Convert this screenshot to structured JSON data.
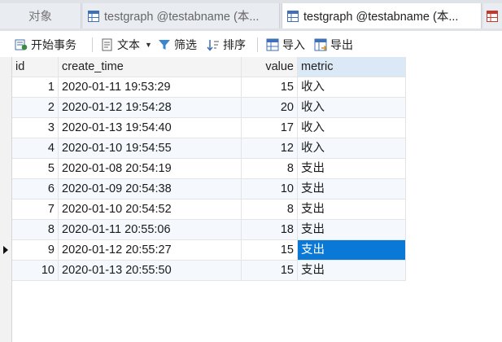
{
  "tabs": {
    "objects": "对象",
    "tab1": "testgraph @testabname (本...",
    "tab2": "testgraph @testabname (本..."
  },
  "toolbar": {
    "begin_transaction": "开始事务",
    "text": "文本",
    "filter": "筛选",
    "sort": "排序",
    "import": "导入",
    "export": "导出"
  },
  "table": {
    "columns": [
      "id",
      "create_time",
      "value",
      "metric"
    ],
    "rows": [
      {
        "id": "1",
        "create_time": "2020-01-11 19:53:29",
        "value": "15",
        "metric": "收入"
      },
      {
        "id": "2",
        "create_time": "2020-01-12 19:54:28",
        "value": "20",
        "metric": "收入"
      },
      {
        "id": "3",
        "create_time": "2020-01-13 19:54:40",
        "value": "17",
        "metric": "收入"
      },
      {
        "id": "4",
        "create_time": "2020-01-10 19:54:55",
        "value": "12",
        "metric": "收入"
      },
      {
        "id": "5",
        "create_time": "2020-01-08 20:54:19",
        "value": "8",
        "metric": "支出"
      },
      {
        "id": "6",
        "create_time": "2020-01-09 20:54:38",
        "value": "10",
        "metric": "支出"
      },
      {
        "id": "7",
        "create_time": "2020-01-10 20:54:52",
        "value": "8",
        "metric": "支出"
      },
      {
        "id": "8",
        "create_time": "2020-01-11 20:55:06",
        "value": "18",
        "metric": "支出"
      },
      {
        "id": "9",
        "create_time": "2020-01-12 20:55:27",
        "value": "15",
        "metric": "支出"
      },
      {
        "id": "10",
        "create_time": "2020-01-13 20:55:50",
        "value": "15",
        "metric": "支出"
      }
    ],
    "selected_row": 8,
    "selected_column": "metric"
  },
  "colors": {
    "selection": "#0a78d7",
    "header_active": "#dbe8f6",
    "tabbar": "#dfe3e8"
  },
  "icons": [
    "table-icon",
    "begin-transaction-icon",
    "text-icon",
    "filter-icon",
    "sort-icon",
    "import-icon",
    "export-icon",
    "row-marker-icon"
  ]
}
